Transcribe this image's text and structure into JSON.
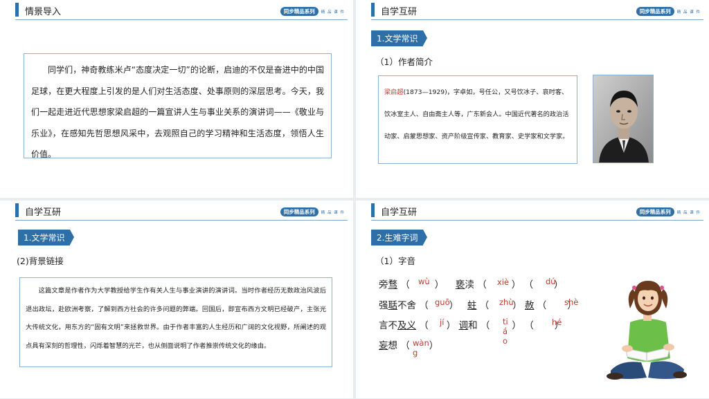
{
  "brand": {
    "series": "同步精品系列",
    "sub": "精 品 课 件"
  },
  "slide1": {
    "header": "情景导入",
    "text": "同学们，神奇教练米卢“态度决定一切”的论断，启迪的不仅是奋进中的中国足球，在更大程度上引发的是人们对生活态度、处事原则的深层思考。今天，我们一起走进近代思想家梁启超的一篇宣讲人生与事业关系的演讲词——《敬业与乐业》，在感知先哲思想风采中，去观照自己的学习精神和生活态度，领悟人生价值。"
  },
  "slide2": {
    "header": "自学互研",
    "tag": "1.文学常识",
    "subheading": "（1）作者简介",
    "bio_name": "梁启超",
    "bio_text": "(1873—1929)，字卓如，号任公，又号饮冰子、哀时客、饮冰室主人、自由斋主人等，广东新会人。中国近代著名的政治活动家、启蒙思想家、资产阶级宣传家、教育家、史学家和文学家。"
  },
  "slide3": {
    "header": "自学互研",
    "tag": "1.文学常识",
    "subheading": "(2)背景链接",
    "text": "这篇文章是作者作为大学教授给学生作有关人生与事业演讲的演讲词。当时作者经历无数政治风波后退出政坛，赴欧洲考察，了解到西方社会的许多问题的弊端。回国后，即宣布西方文明已经破产，主张光大传统文化，用东方的“固有文明”来拯救世界。由于作者丰富的人生经历和广阔的文化视野，所阐述的观点具有深刻的哲理性，闪烁着智慧的光芒，也从侧面说明了作者推崇传统文化的缘由。"
  },
  "slide4": {
    "header": "自学互研",
    "tag": "2.生难字词",
    "subheading": "（1）字音",
    "row1": {
      "w1a": "旁",
      "w1b": "骛",
      "p1": "wù",
      "w2a": "亵",
      "w2b": "渎",
      "p2": "xiè",
      "p3": "dú"
    },
    "row2": {
      "w1a": "强",
      "w1b": "聒",
      "w1c": "不舍",
      "p1": "guō",
      "w2": "蛀",
      "p2": "zhù",
      "w3": "赦",
      "p3": "shè"
    },
    "row3": {
      "w1a": "言不",
      "w1b": "及义",
      "p1": "jí",
      "w2a": "调",
      "w2b": "和",
      "p2": "tiáo",
      "p3": "hé"
    },
    "row4": {
      "w1a": "妄",
      "w1b": "想",
      "p1": "wàng"
    }
  }
}
